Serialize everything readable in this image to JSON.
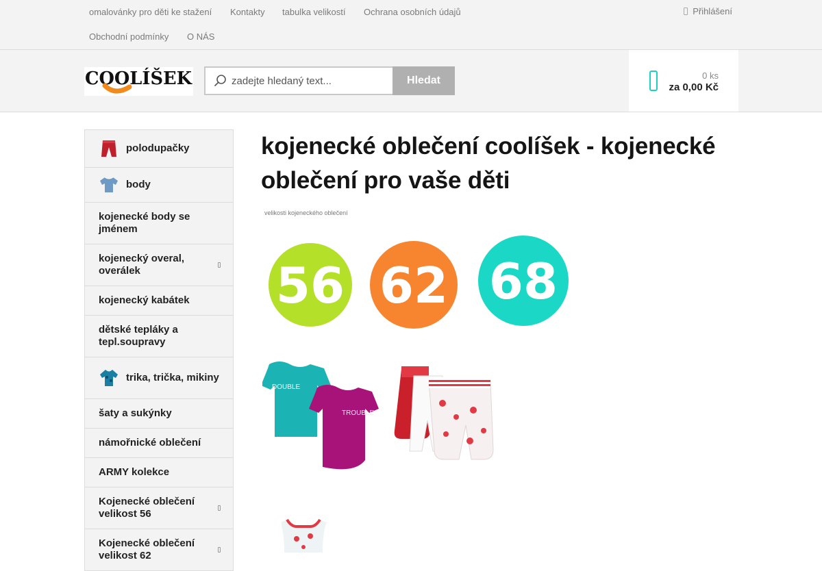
{
  "topnav": {
    "links": [
      "omalovánky pro děti ke stažení",
      "Kontakty",
      "tabulka velikostí",
      "Ochrana osobních údajů",
      "Obchodní podmínky",
      "O NÁS"
    ],
    "login_label": "Přihlášení"
  },
  "header": {
    "logo_text": "COOLÍŠEK",
    "search_placeholder": "zadejte hledaný text...",
    "search_button": "Hledat",
    "cart_count": "0 ks",
    "cart_total": "za 0,00 Kč"
  },
  "sidebar": {
    "items": [
      "polodupačky",
      "body",
      "kojenecké body se jménem",
      "kojenecký overal, overálek",
      "kojenecký kabátek",
      "dětské tepláky a tepl.soupravy",
      "trika, trička, mikiny",
      "šaty a sukýnky",
      "námořnické oblečení",
      "ARMY kolekce",
      "Kojenecké oblečení velikost 56",
      "Kojenecké oblečení velikost 62"
    ]
  },
  "main": {
    "title": "kojenecké oblečení coolíšek - kojenecké oblečení pro vaše děti",
    "caption": "velikosti kojeneckého oblečení",
    "product_labels": [
      "DOUBLE",
      "TROUBLE"
    ]
  },
  "colors": {
    "accent": "#1fcfc0",
    "circle_green": "#b5e02a",
    "circle_orange": "#f7842f",
    "circle_teal": "#1bd8c6"
  },
  "chart_data": {
    "type": "bubble",
    "categories": [
      "56",
      "62",
      "68"
    ],
    "values": [
      56,
      62,
      68
    ],
    "colors": [
      "#b5e02a",
      "#f7842f",
      "#1bd8c6"
    ],
    "title": "velikosti kojeneckého oblečení"
  }
}
